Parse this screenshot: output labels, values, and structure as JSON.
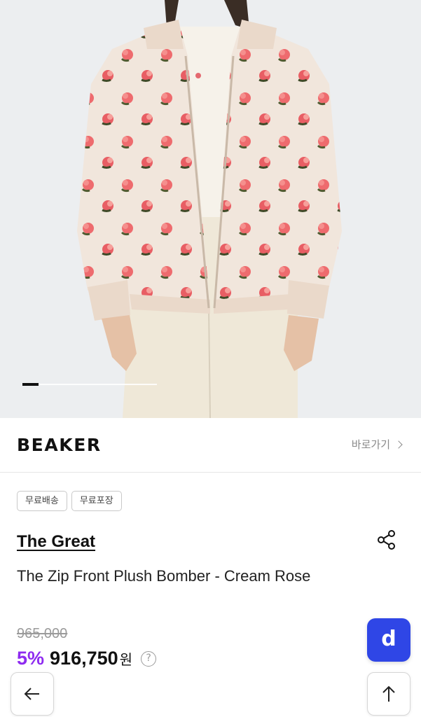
{
  "gallery": {
    "image_alt": "The Zip Front Plush Bomber - Cream Rose",
    "progress_fraction": 0.12
  },
  "brandbar": {
    "logo_text": "BEAKER",
    "shortcut_label": "바로가기"
  },
  "tags": [
    "무료배송",
    "무료포장"
  ],
  "product": {
    "brand": "The Great",
    "title": "The Zip Front Plush Bomber - Cream Rose",
    "original_price": "965,000",
    "discount": "5%",
    "price": "916,750",
    "currency": "원",
    "help": "?"
  },
  "fab": {
    "label": "d",
    "color": "#2f46e6"
  },
  "icons": {
    "share": "share-icon",
    "back": "arrow-left-icon",
    "top": "arrow-up-icon"
  },
  "colors": {
    "discount": "#8e2bf0",
    "accent": "#2f46e6"
  }
}
